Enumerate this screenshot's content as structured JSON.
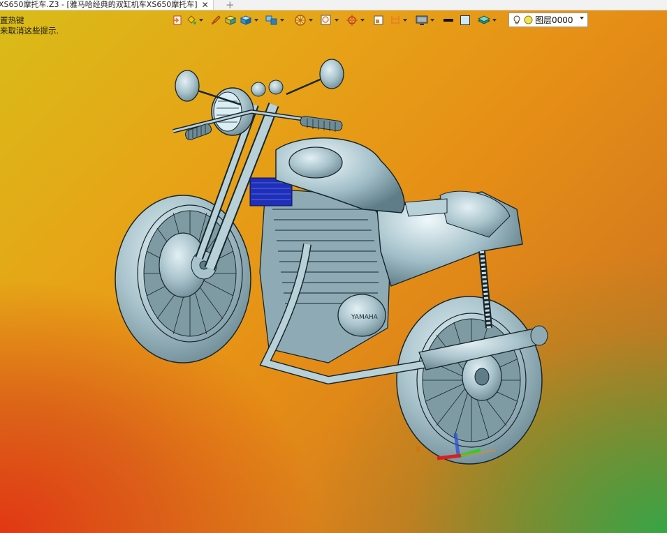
{
  "tab": {
    "title": "XS650摩托车.Z3 - [雅马哈经典的双缸机车XS650摩托车]",
    "close_icon": "close-icon",
    "add_icon": "plus-icon"
  },
  "hints": {
    "line1": "置热键",
    "line2": "来取消这些提示."
  },
  "toolbar": {
    "buttons": [
      {
        "icon": "import-icon",
        "dropdown": false
      },
      {
        "icon": "paint-bucket-icon",
        "dropdown": true
      },
      {
        "icon": "brush-icon",
        "dropdown": false
      },
      {
        "icon": "shaded-solid-icon",
        "dropdown": false
      },
      {
        "icon": "cube-view-icon",
        "dropdown": true
      },
      {
        "icon": "multi-view-icon",
        "dropdown": true
      },
      {
        "icon": "display-filter-icon",
        "dropdown": true
      },
      {
        "icon": "zoom-window-icon",
        "dropdown": true
      },
      {
        "icon": "snap-target-icon",
        "dropdown": true
      },
      {
        "icon": "workplane-icon",
        "dropdown": false
      },
      {
        "icon": "dimension-icon",
        "dropdown": true
      },
      {
        "icon": "monitor-icon",
        "dropdown": true
      },
      {
        "icon": "line-color-icon",
        "dropdown": false
      },
      {
        "icon": "fill-color-icon",
        "dropdown": false
      },
      {
        "icon": "layer-stack-icon",
        "dropdown": true
      }
    ]
  },
  "layer": {
    "name": "图层0000",
    "bulb_icon": "lightbulb-icon",
    "dot_icon": "layer-status-icon"
  },
  "model": {
    "brand_text": "YAMAHA"
  },
  "triad": {
    "x_label": "X",
    "axis_x_color": "#d82020",
    "axis_y_color": "#2ecc2e",
    "axis_z_color": "#2a4fd8"
  },
  "colors": {
    "model_fill": "#a9c3cc",
    "model_stroke": "#16262c",
    "accent_blue": "#1f2fb8"
  }
}
